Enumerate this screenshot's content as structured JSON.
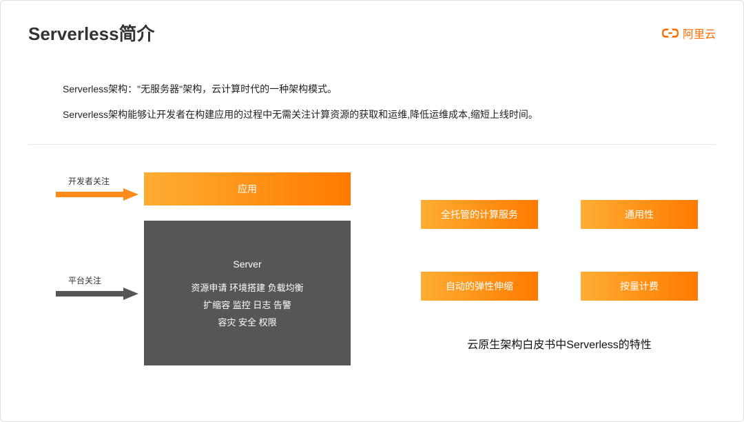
{
  "header": {
    "title": "Serverless简介",
    "logo_text": "阿里云"
  },
  "intro": {
    "line1": "Serverless架构：\"无服务器\"架构，云计算时代的一种架构模式。",
    "line2": "Serverless架构能够让开发者在构建应用的过程中无需关注计算资源的获取和运维,降低运维成本,缩短上线时间。"
  },
  "diagram": {
    "dev_label": "开发者关注",
    "platform_label": "平台关注",
    "app_box": "应用",
    "server_title": "Server",
    "server_line1": "资源申请 环境搭建 负载均衡",
    "server_line2": "扩缩容 监控 日志 告警",
    "server_line3": "容灾  安全  权限"
  },
  "features": {
    "f1": "全托管的计算服务",
    "f2": "通用性",
    "f3": "自动的弹性伸缩",
    "f4": "按量计费",
    "caption": "云原生架构白皮书中Serverless的特性"
  }
}
